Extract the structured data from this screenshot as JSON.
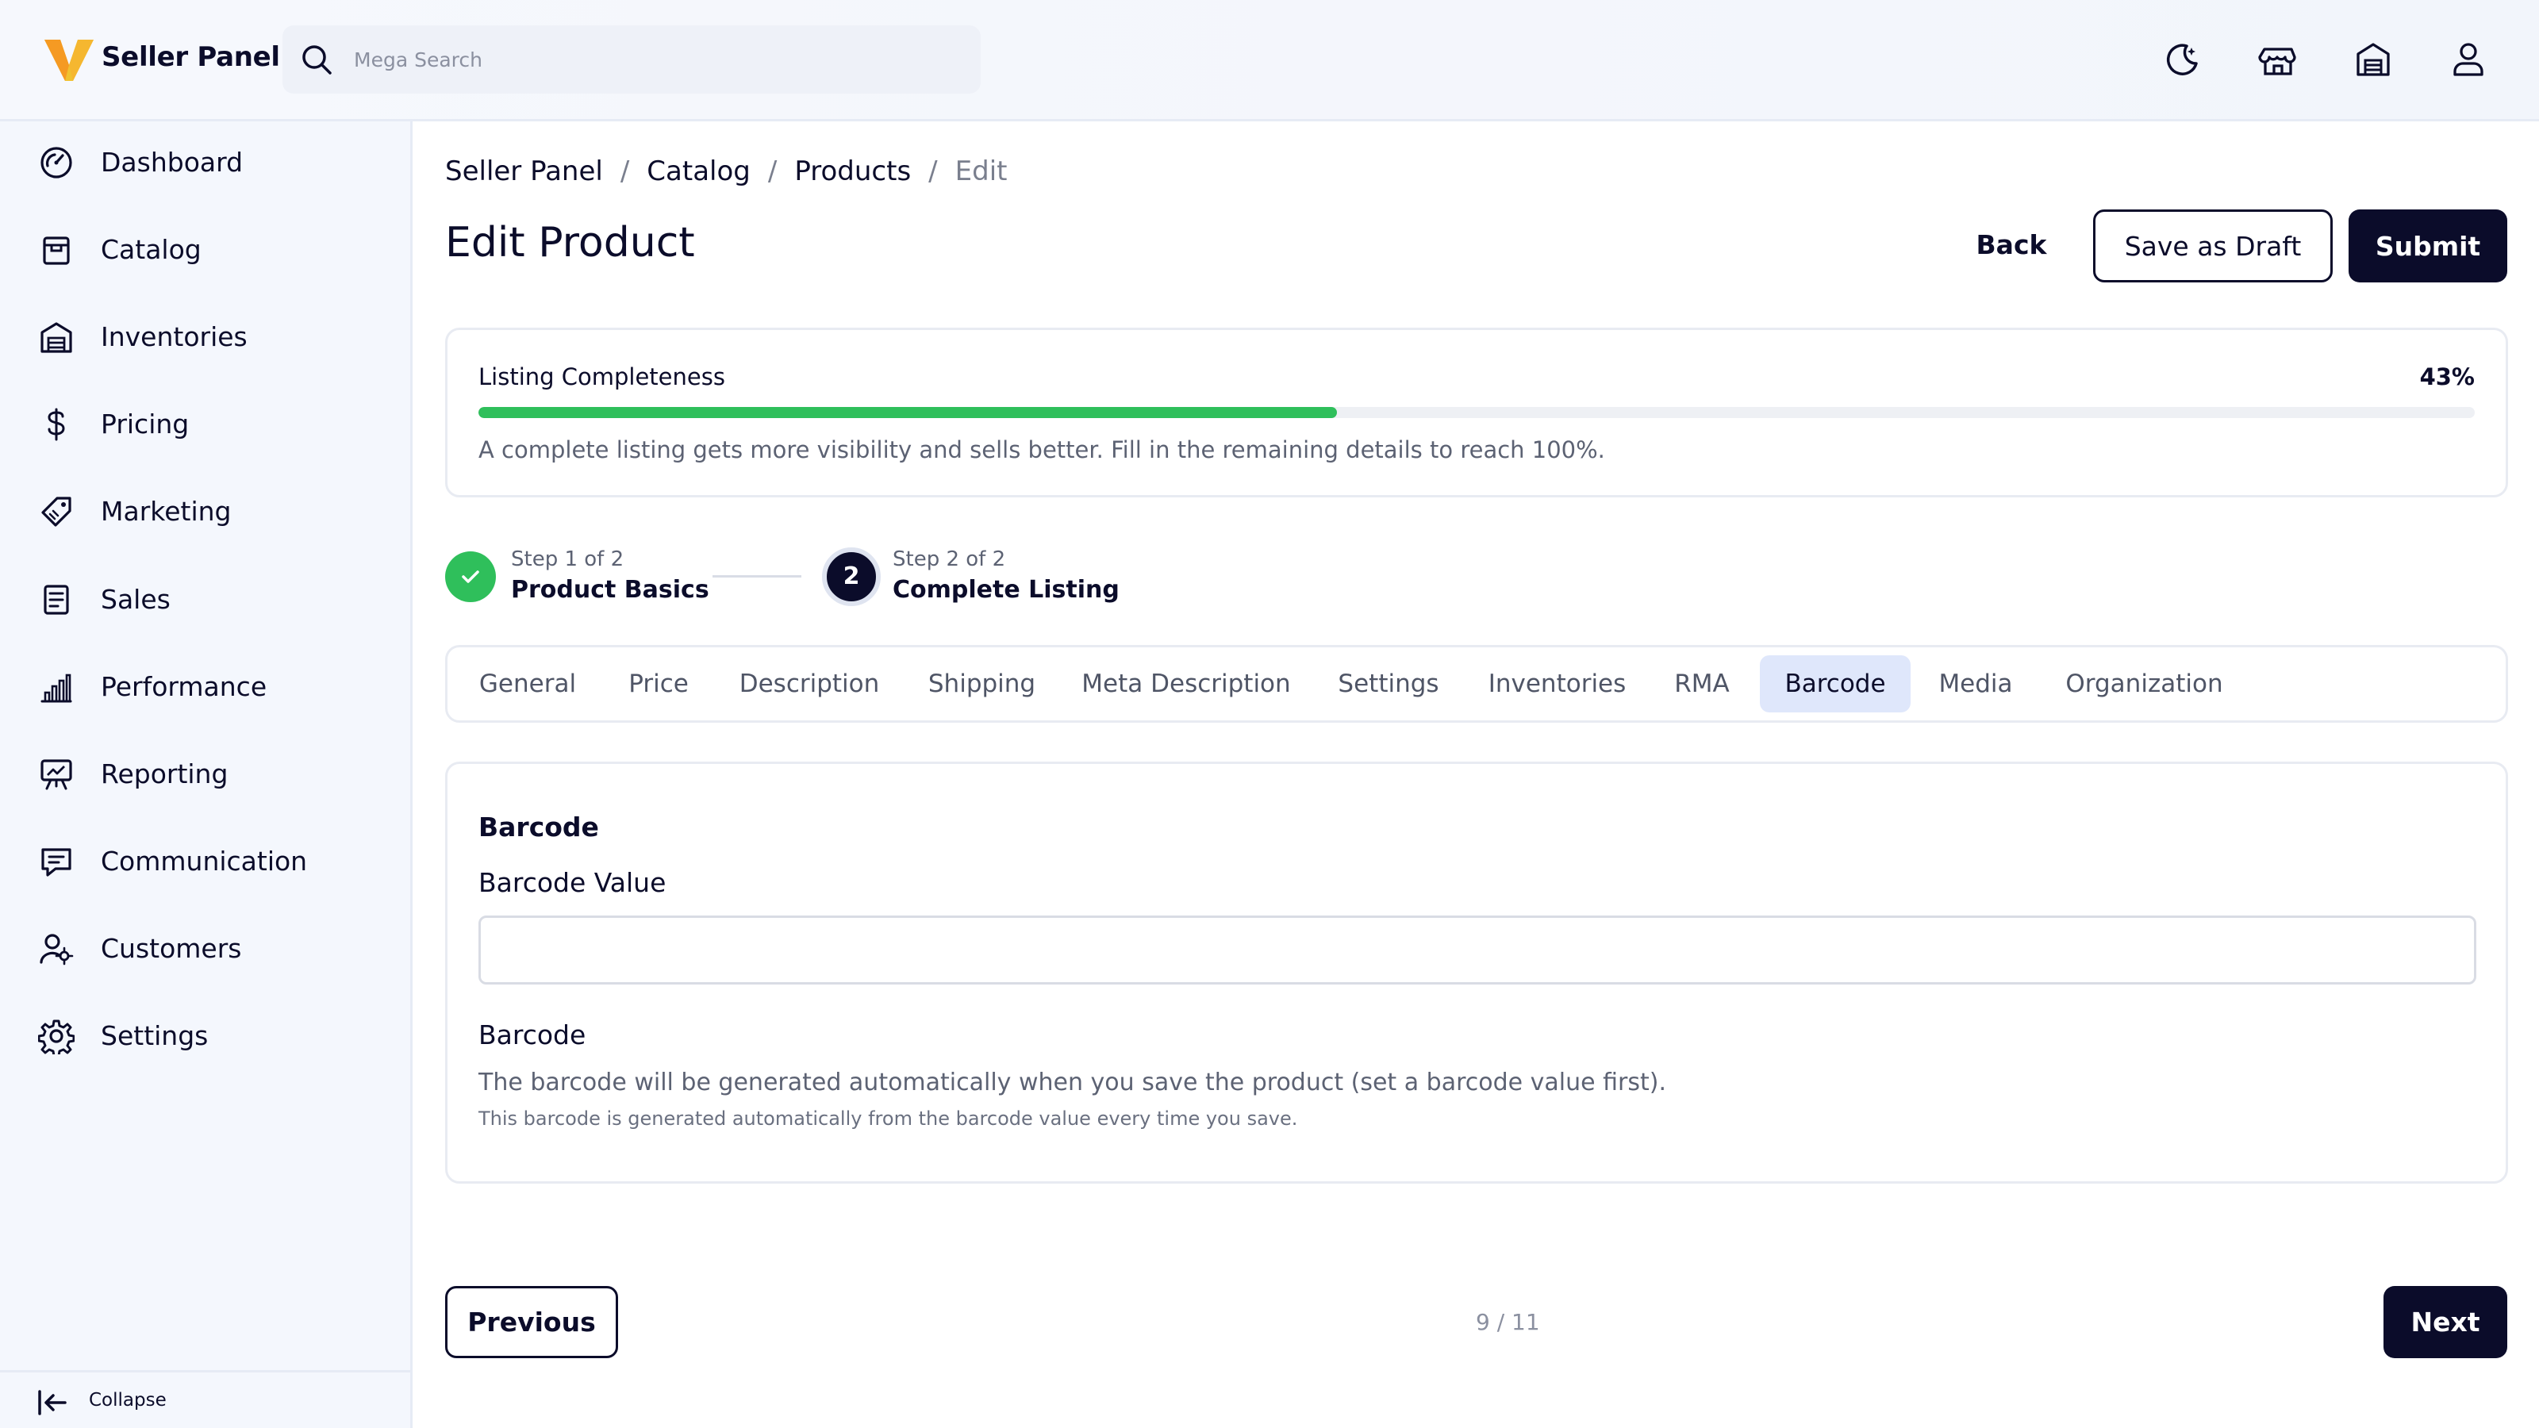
{
  "header": {
    "brand": "Seller Panel",
    "logo_icon": "v-logo-icon",
    "search": {
      "placeholder": "Mega Search",
      "value": ""
    },
    "icons": [
      "theme-toggle-icon",
      "store-icon",
      "warehouse-icon",
      "user-icon"
    ]
  },
  "sidebar": {
    "items": [
      {
        "label": "Dashboard",
        "icon": "dashboard-icon"
      },
      {
        "label": "Catalog",
        "icon": "catalog-icon"
      },
      {
        "label": "Inventories",
        "icon": "warehouse-icon"
      },
      {
        "label": "Pricing",
        "icon": "dollar-icon"
      },
      {
        "label": "Marketing",
        "icon": "tag-icon"
      },
      {
        "label": "Sales",
        "icon": "receipt-icon"
      },
      {
        "label": "Performance",
        "icon": "bar-chart-icon"
      },
      {
        "label": "Reporting",
        "icon": "presentation-icon"
      },
      {
        "label": "Communication",
        "icon": "chat-icon"
      },
      {
        "label": "Customers",
        "icon": "users-icon"
      },
      {
        "label": "Settings",
        "icon": "gear-icon"
      }
    ],
    "collapse_label": "Collapse"
  },
  "breadcrumb": {
    "items": [
      "Seller Panel",
      "Catalog",
      "Products"
    ],
    "current": "Edit",
    "separator": "/"
  },
  "page": {
    "title": "Edit Product",
    "back_label": "Back",
    "draft_label": "Save as Draft",
    "submit_label": "Submit"
  },
  "completeness": {
    "label": "Listing Completeness",
    "percent_text": "43%",
    "percent": 43,
    "note": "A complete listing gets more visibility and sells better. Fill in the remaining details to reach 100%."
  },
  "steps": [
    {
      "small": "Step 1 of 2",
      "title": "Product Basics",
      "state": "done"
    },
    {
      "small": "Step 2 of 2",
      "title": "Complete Listing",
      "number": "2",
      "state": "active"
    }
  ],
  "tabs": [
    {
      "label": "General"
    },
    {
      "label": "Price"
    },
    {
      "label": "Description"
    },
    {
      "label": "Shipping"
    },
    {
      "label": "Meta Description"
    },
    {
      "label": "Settings"
    },
    {
      "label": "Inventories"
    },
    {
      "label": "RMA"
    },
    {
      "label": "Barcode",
      "active": true
    },
    {
      "label": "Media"
    },
    {
      "label": "Organization"
    }
  ],
  "barcode_section": {
    "title": "Barcode",
    "value_label": "Barcode Value",
    "value": "",
    "barcode_label": "Barcode",
    "help_primary": "The barcode will be generated automatically when you save the product (set a barcode value first).",
    "help_secondary": "This barcode is generated automatically from the barcode value every time you save."
  },
  "footer": {
    "previous_label": "Previous",
    "pager": "9 / 11",
    "next_label": "Next"
  },
  "colors": {
    "primary": "#0b0c2a",
    "success": "#2fbf5b",
    "active_tab_bg": "#dfe7fb",
    "logo_orange": "#f5a623",
    "logo_gold": "#f0c230"
  }
}
